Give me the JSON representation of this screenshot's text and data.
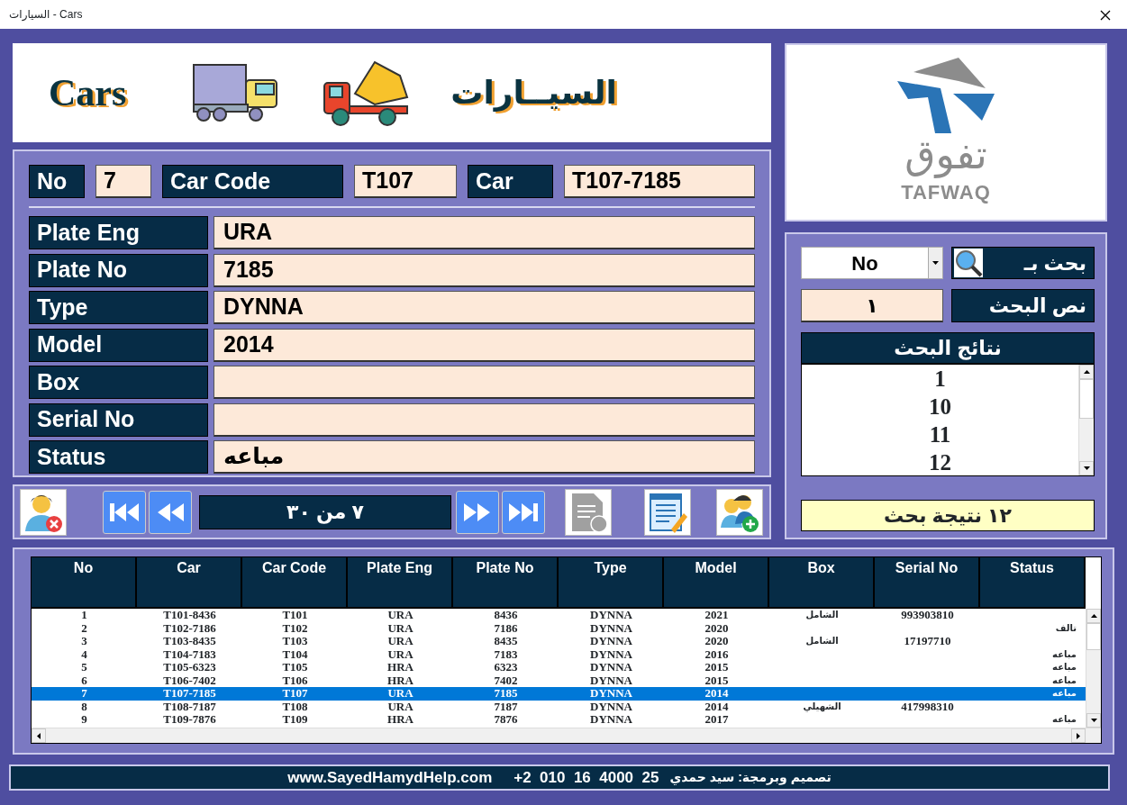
{
  "window": {
    "title": "السيارات - Cars"
  },
  "header": {
    "title_en": "Cars",
    "title_ar": "السيــارات"
  },
  "logo": {
    "arabic": "تفوق",
    "latin": "TAFWAQ"
  },
  "record": {
    "top_fields": [
      {
        "label": "No",
        "value": "7"
      },
      {
        "label": "Car Code",
        "value": "T107"
      },
      {
        "label": "Car",
        "value": "T107-7185"
      }
    ],
    "fields": [
      {
        "label": "Plate Eng",
        "value": "URA"
      },
      {
        "label": "Plate No",
        "value": "7185"
      },
      {
        "label": "Type",
        "value": "DYNNA"
      },
      {
        "label": "Model",
        "value": "2014"
      },
      {
        "label": "Box"
      },
      {
        "label": "Serial No"
      },
      {
        "label": "Status",
        "value": "مباعه"
      }
    ]
  },
  "navigator": {
    "position": "٧ من ٣٠"
  },
  "search": {
    "by_label": "بحث بـ",
    "by_value": "No",
    "text_label": "نص البحث",
    "text_value": "١",
    "results_title": "نتائج البحث",
    "results": [
      "1",
      "10",
      "11",
      "12"
    ],
    "count": "١٢ نتيجة بحث"
  },
  "table": {
    "columns": [
      "No",
      "Car",
      "Car Code",
      "Plate Eng",
      "Plate No",
      "Type",
      "Model",
      "Box",
      "Serial No",
      "Status"
    ],
    "rows": [
      {
        "selected": false,
        "cells": [
          "1",
          "T101-8436",
          "T101",
          "URA",
          "8436",
          "DYNNA",
          "2021",
          "الشامل",
          "993903810",
          null
        ]
      },
      {
        "selected": false,
        "cells": [
          "2",
          "T102-7186",
          "T102",
          "URA",
          "7186",
          "DYNNA",
          "2020",
          null,
          null,
          "تالف"
        ]
      },
      {
        "selected": false,
        "cells": [
          "3",
          "T103-8435",
          "T103",
          "URA",
          "8435",
          "DYNNA",
          "2020",
          "الشامل",
          "17197710",
          null
        ]
      },
      {
        "selected": false,
        "cells": [
          "4",
          "T104-7183",
          "T104",
          "URA",
          "7183",
          "DYNNA",
          "2016",
          null,
          null,
          "مباعه"
        ]
      },
      {
        "selected": false,
        "cells": [
          "5",
          "T105-6323",
          "T105",
          "HRA",
          "6323",
          "DYNNA",
          "2015",
          null,
          null,
          "مباعه"
        ]
      },
      {
        "selected": false,
        "cells": [
          "6",
          "T106-7402",
          "T106",
          "HRA",
          "7402",
          "DYNNA",
          "2015",
          null,
          null,
          "مباعه"
        ]
      },
      {
        "selected": true,
        "cells": [
          "7",
          "T107-7185",
          "T107",
          "URA",
          "7185",
          "DYNNA",
          "2014",
          null,
          null,
          "مباعه"
        ]
      },
      {
        "selected": false,
        "cells": [
          "8",
          "T108-7187",
          "T108",
          "URA",
          "7187",
          "DYNNA",
          "2014",
          "الشهيلي",
          "417998310",
          null
        ]
      },
      {
        "selected": false,
        "cells": [
          "9",
          "T109-7876",
          "T109",
          "HRA",
          "7876",
          "DYNNA",
          "2017",
          null,
          null,
          "مباعه"
        ]
      }
    ]
  },
  "footer": {
    "website": "www.SayedHamydHelp.com",
    "phone": "+2  010  16  4000  25",
    "credit": "تصميم وبرمجة: سيد حمدي"
  }
}
